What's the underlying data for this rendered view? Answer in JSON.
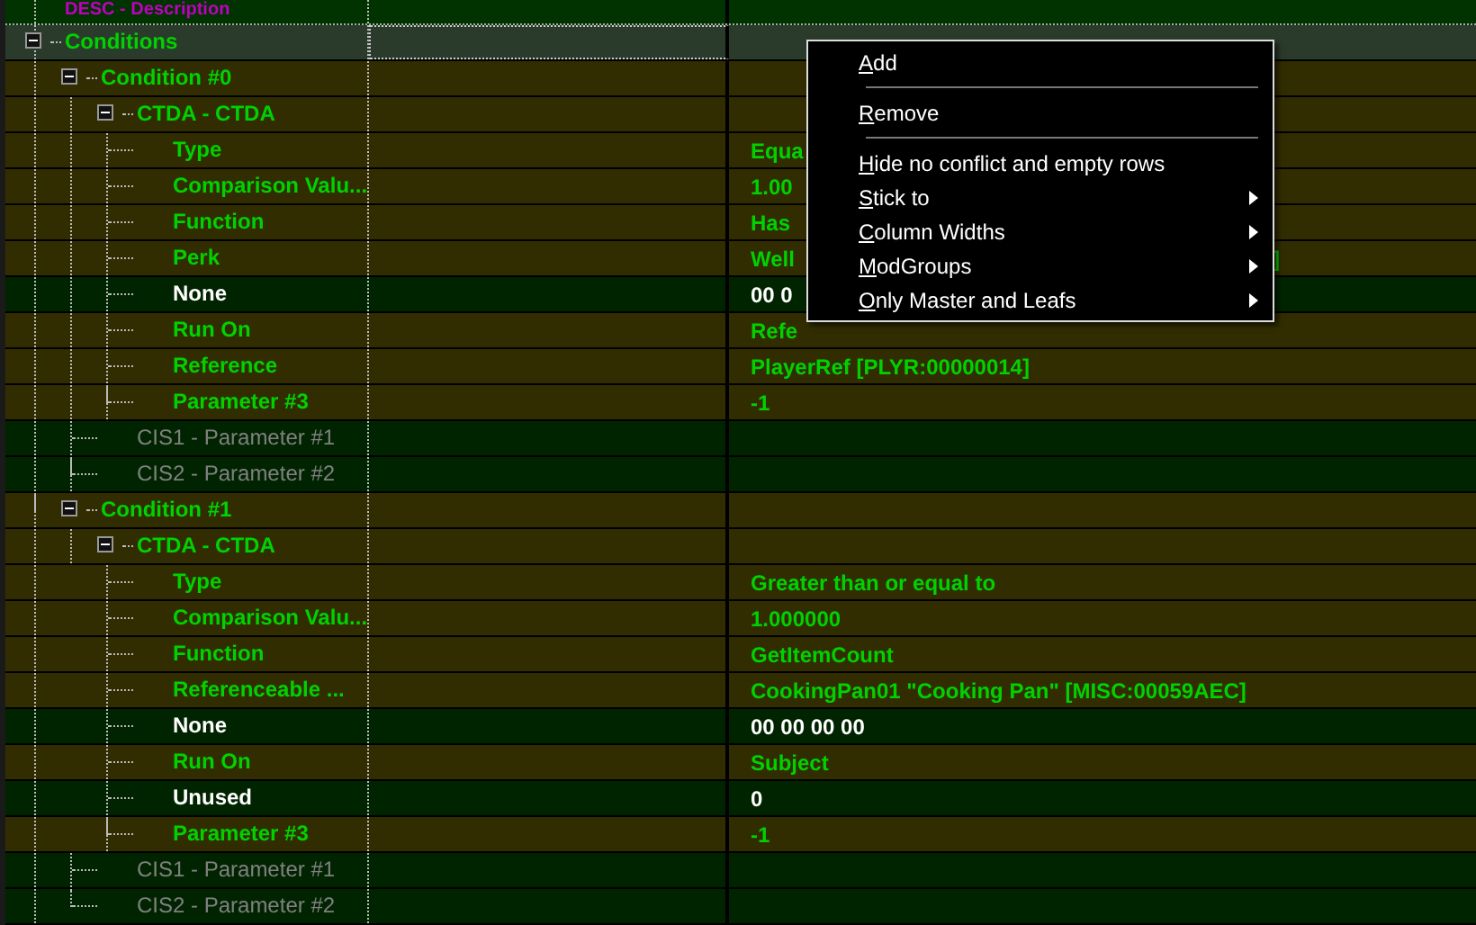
{
  "tree": {
    "top_row": {
      "label": "DESC - Description"
    },
    "rows": [
      {
        "label": "Conditions",
        "kind": "group",
        "selected": true,
        "expanded": true,
        "children": [
          {
            "label": "Condition #0",
            "kind": "group",
            "selected": false,
            "expanded": true,
            "children": [
              {
                "label": "CTDA - CTDA",
                "kind": "group",
                "selected": false,
                "expanded": true,
                "children": [
                  {
                    "label": "Type",
                    "value": "Equa",
                    "kind": "field",
                    "selected": false
                  },
                  {
                    "label": "Comparison Valu...",
                    "value": "1.00",
                    "kind": "field",
                    "selected": false
                  },
                  {
                    "label": "Function",
                    "value": "Has",
                    "kind": "field",
                    "selected": false
                  },
                  {
                    "label": "Perk",
                    "value": "Well",
                    "value_end": "]",
                    "kind": "field",
                    "selected": false
                  },
                  {
                    "label": "None",
                    "value": "00 0",
                    "kind": "differ",
                    "selected": false
                  },
                  {
                    "label": "Run On",
                    "value": "Refe",
                    "kind": "field",
                    "selected": false
                  },
                  {
                    "label": "Reference",
                    "value": "PlayerRef [PLYR:00000014]",
                    "kind": "field",
                    "selected": false
                  },
                  {
                    "label": "Parameter #3",
                    "value": "-1",
                    "kind": "field",
                    "selected": false
                  }
                ]
              },
              {
                "label": "CIS1 - Parameter #1",
                "kind": "absent",
                "selected": false
              },
              {
                "label": "CIS2 - Parameter #2",
                "kind": "absent",
                "selected": false
              }
            ]
          },
          {
            "label": "Condition #1",
            "kind": "group",
            "selected": false,
            "expanded": true,
            "children": [
              {
                "label": "CTDA - CTDA",
                "kind": "group",
                "selected": false,
                "expanded": true,
                "children": [
                  {
                    "label": "Type",
                    "value": "Greater than or equal to",
                    "kind": "field",
                    "selected": false
                  },
                  {
                    "label": "Comparison Valu...",
                    "value": "1.000000",
                    "kind": "field",
                    "selected": false
                  },
                  {
                    "label": "Function",
                    "value": "GetItemCount",
                    "kind": "field",
                    "selected": false
                  },
                  {
                    "label": "Referenceable ...",
                    "value": "CookingPan01 \"Cooking Pan\" [MISC:00059AEC]",
                    "kind": "field",
                    "selected": false
                  },
                  {
                    "label": "None",
                    "value": "00 00 00 00",
                    "kind": "differ",
                    "selected": false
                  },
                  {
                    "label": "Run On",
                    "value": "Subject",
                    "kind": "field",
                    "selected": false
                  },
                  {
                    "label": "Unused",
                    "value": "0",
                    "kind": "differ",
                    "selected": false
                  },
                  {
                    "label": "Parameter #3",
                    "value": "-1",
                    "kind": "field",
                    "selected": false
                  }
                ]
              },
              {
                "label": "CIS1 - Parameter #1",
                "kind": "absent",
                "selected": false
              },
              {
                "label": "CIS2 - Parameter #2",
                "kind": "absent",
                "selected": false
              }
            ]
          }
        ]
      }
    ]
  },
  "context_menu": {
    "items": [
      {
        "label": "Add",
        "kind": "item",
        "submenu": false
      },
      {
        "kind": "separator"
      },
      {
        "label": "Remove",
        "kind": "item",
        "submenu": false
      },
      {
        "kind": "separator"
      },
      {
        "label": "Hide no conflict and empty rows",
        "kind": "item",
        "submenu": false
      },
      {
        "label": "Stick to",
        "kind": "item",
        "submenu": true
      },
      {
        "label": "Column Widths",
        "kind": "item",
        "submenu": true
      },
      {
        "label": "ModGroups",
        "kind": "item",
        "submenu": true
      },
      {
        "label": "Only Master and Leafs",
        "kind": "item",
        "submenu": true
      }
    ]
  }
}
